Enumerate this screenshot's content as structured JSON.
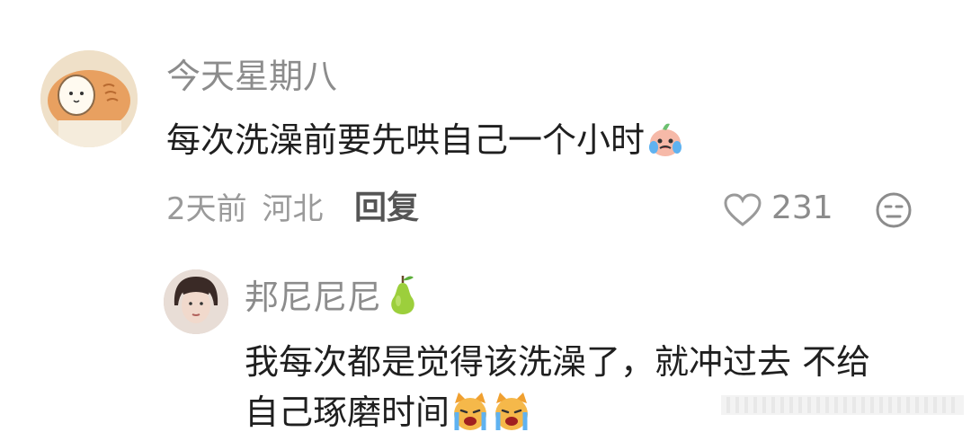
{
  "comment": {
    "username": "今天星期八",
    "text": "每次洗澡前要先哄自己一个小时",
    "time": "2天前",
    "location": "河北",
    "reply_label": "回复",
    "likes": "231",
    "icons": [
      "avatar",
      "crying-emoji",
      "heart-icon",
      "dislike-face-icon"
    ]
  },
  "reply": {
    "username": "邦尼尼尼",
    "line1": "我每次都是觉得该洗澡了，就冲过去 不给",
    "line2": "自己琢磨时间",
    "icons": [
      "avatar",
      "pear-icon",
      "cat-crying-emoji"
    ]
  },
  "colors": {
    "name": "#8c8c8c",
    "text": "#1f1f1f",
    "meta": "#9a9a9a"
  }
}
